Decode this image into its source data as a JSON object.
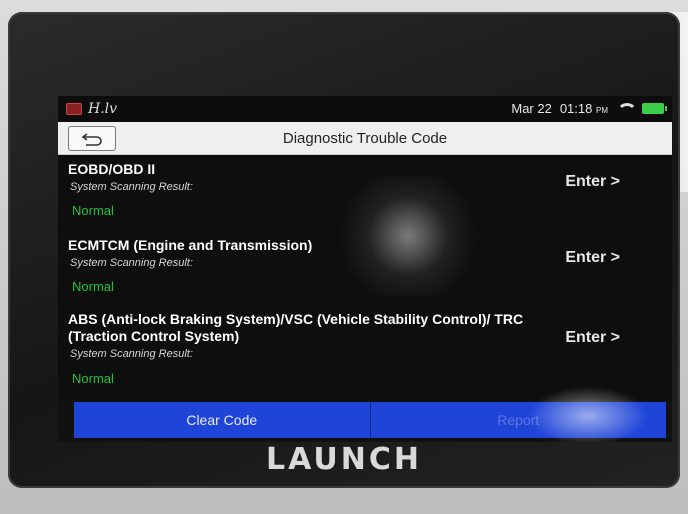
{
  "status_bar": {
    "signal_text": "H.lv",
    "date": "Mar 22",
    "time": "01:18",
    "time_suffix": "PM"
  },
  "header": {
    "title": "Diagnostic Trouble Code"
  },
  "systems": [
    {
      "name": "EOBD/OBD II",
      "result_label": "System Scanning Result:",
      "status": "Normal",
      "enter_label": "Enter >"
    },
    {
      "name": "ECMTCM (Engine and Transmission)",
      "result_label": "System Scanning Result:",
      "status": "Normal",
      "enter_label": "Enter >"
    },
    {
      "name": "ABS (Anti-lock Braking System)/VSC (Vehicle Stability Control)/ TRC (Traction Control System)",
      "result_label": "System Scanning Result:",
      "status": "Normal",
      "enter_label": "Enter >"
    }
  ],
  "actions": {
    "clear_code": "Clear Code",
    "report": "Report"
  },
  "device": {
    "brand": "LAUNCH"
  },
  "colors": {
    "status_normal": "#1fc43c",
    "button_blue": "#1f45d8",
    "titlebar_bg": "#efefef"
  }
}
